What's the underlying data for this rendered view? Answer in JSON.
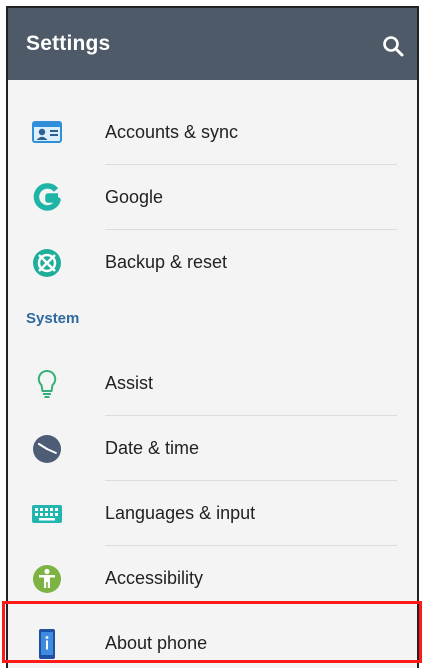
{
  "appbar": {
    "title": "Settings",
    "search_icon": "search-icon"
  },
  "items": [
    {
      "label": "Accounts & sync",
      "icon": "accounts-icon"
    },
    {
      "label": "Google",
      "icon": "google-icon"
    },
    {
      "label": "Backup & reset",
      "icon": "backup-icon"
    },
    {
      "label": "Assist",
      "icon": "assist-icon"
    },
    {
      "label": "Date & time",
      "icon": "clock-icon"
    },
    {
      "label": "Languages & input",
      "icon": "keyboard-icon"
    },
    {
      "label": "Accessibility",
      "icon": "accessibility-icon"
    },
    {
      "label": "About phone",
      "icon": "phone-info-icon"
    }
  ],
  "sections": {
    "system": "System"
  },
  "colors": {
    "appbar": "#4e5a68",
    "section_header": "#2e6aa0",
    "highlight": "#ff1a1a"
  }
}
